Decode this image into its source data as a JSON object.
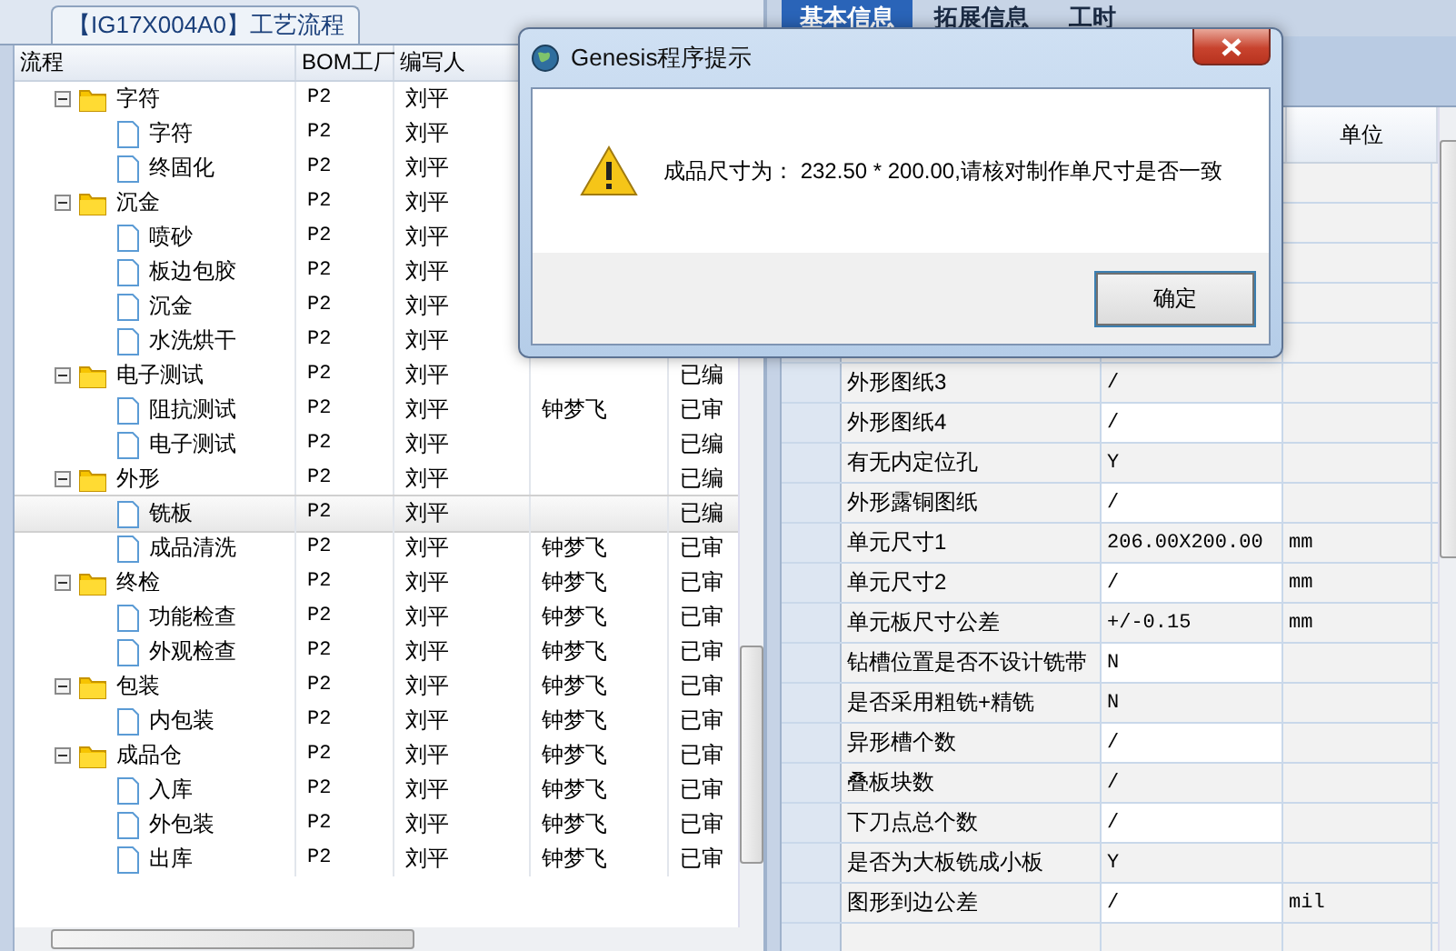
{
  "left_panel": {
    "tab": "【IG17X004A0】工艺流程",
    "columns": [
      "流程",
      "BOM工厂",
      "编写人"
    ],
    "tree": [
      {
        "name": "字符",
        "factory": "P2",
        "author": "刘平",
        "expanded": true,
        "selected": false,
        "children": [
          {
            "name": "字符",
            "factory": "P2",
            "author": "刘平",
            "selected": false
          },
          {
            "name": "终固化",
            "factory": "P2",
            "author": "刘平",
            "selected": false
          }
        ]
      },
      {
        "name": "沉金",
        "factory": "P2",
        "author": "刘平",
        "expanded": true,
        "selected": false,
        "children": [
          {
            "name": "喷砂",
            "factory": "P2",
            "author": "刘平",
            "selected": false
          },
          {
            "name": "板边包胶",
            "factory": "P2",
            "author": "刘平",
            "selected": false
          },
          {
            "name": "沉金",
            "factory": "P2",
            "author": "刘平",
            "selected": false
          },
          {
            "name": "水洗烘干",
            "factory": "P2",
            "author": "刘平",
            "selected": false
          }
        ]
      },
      {
        "name": "电子测试",
        "factory": "P2",
        "author": "刘平",
        "status": "已编",
        "expanded": true,
        "selected": false,
        "children": [
          {
            "name": "阻抗测试",
            "factory": "P2",
            "author": "刘平",
            "reviewer": "钟梦飞",
            "status": "已审",
            "selected": false
          },
          {
            "name": "电子测试",
            "factory": "P2",
            "author": "刘平",
            "status": "已编",
            "selected": false
          }
        ]
      },
      {
        "name": "外形",
        "factory": "P2",
        "author": "刘平",
        "status": "已编",
        "expanded": true,
        "selected": false,
        "children": [
          {
            "name": "铣板",
            "factory": "P2",
            "author": "刘平",
            "status": "已编",
            "selected": true
          },
          {
            "name": "成品清洗",
            "factory": "P2",
            "author": "刘平",
            "reviewer": "钟梦飞",
            "status": "已审",
            "selected": false
          }
        ]
      },
      {
        "name": "终检",
        "factory": "P2",
        "author": "刘平",
        "reviewer": "钟梦飞",
        "status": "已审",
        "expanded": true,
        "selected": false,
        "children": [
          {
            "name": "功能检查",
            "factory": "P2",
            "author": "刘平",
            "reviewer": "钟梦飞",
            "status": "已审",
            "selected": false
          },
          {
            "name": "外观检查",
            "factory": "P2",
            "author": "刘平",
            "reviewer": "钟梦飞",
            "status": "已审",
            "selected": false
          }
        ]
      },
      {
        "name": "包装",
        "factory": "P2",
        "author": "刘平",
        "reviewer": "钟梦飞",
        "status": "已审",
        "expanded": true,
        "selected": false,
        "children": [
          {
            "name": "内包装",
            "factory": "P2",
            "author": "刘平",
            "reviewer": "钟梦飞",
            "status": "已审",
            "selected": false
          }
        ]
      },
      {
        "name": "成品仓",
        "factory": "P2",
        "author": "刘平",
        "reviewer": "钟梦飞",
        "status": "已审",
        "expanded": true,
        "selected": false,
        "children": [
          {
            "name": "入库",
            "factory": "P2",
            "author": "刘平",
            "reviewer": "钟梦飞",
            "status": "已审",
            "selected": false
          },
          {
            "name": "外包装",
            "factory": "P2",
            "author": "刘平",
            "reviewer": "钟梦飞",
            "status": "已审",
            "selected": false
          },
          {
            "name": "出库",
            "factory": "P2",
            "author": "刘平",
            "reviewer": "钟梦飞",
            "status": "已审",
            "selected": false
          }
        ]
      }
    ]
  },
  "right_panel": {
    "tabs": [
      {
        "label": "基本信息",
        "selected": true
      },
      {
        "label": "拓展信息",
        "selected": false
      },
      {
        "label": "工时",
        "selected": false
      }
    ],
    "unit_header": "单位",
    "rows": [
      {
        "name": "外形图纸3",
        "value": "/"
      },
      {
        "name": "外形图纸4",
        "value": "/"
      },
      {
        "name": "有无内定位孔",
        "value": "Y"
      },
      {
        "name": "外形露铜图纸",
        "value": "/"
      },
      {
        "name": "单元尺寸1",
        "value": "206.00X200.00",
        "unit": "mm"
      },
      {
        "name": "单元尺寸2",
        "value": "/",
        "unit": "mm"
      },
      {
        "name": "单元板尺寸公差",
        "value": "+/-0.15",
        "unit": "mm"
      },
      {
        "name": "钻槽位置是否不设计铣带",
        "value": "N"
      },
      {
        "name": "是否采用粗铣+精铣",
        "value": "N"
      },
      {
        "name": "异形槽个数",
        "value": "/"
      },
      {
        "name": "叠板块数",
        "value": "/"
      },
      {
        "name": "下刀点总个数",
        "value": "/"
      },
      {
        "name": "是否为大板铣成小板",
        "value": "Y"
      },
      {
        "name": "图形到边公差",
        "value": "/",
        "unit": "mil"
      }
    ]
  },
  "dialog": {
    "title": "Genesis程序提示",
    "message": "成品尺寸为： 232.50 * 200.00,请核对制作单尺寸是否一致",
    "button": "确定"
  }
}
